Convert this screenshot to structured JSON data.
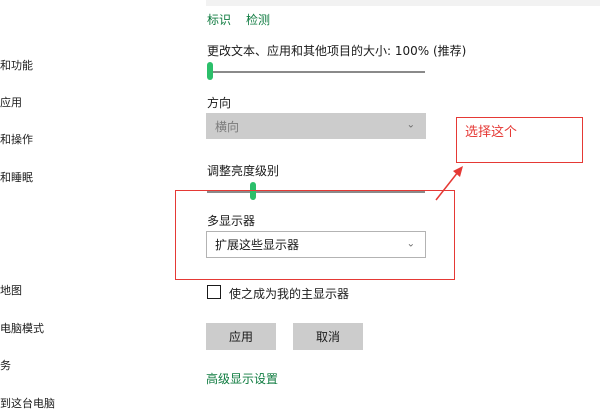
{
  "sidebar": {
    "items": [
      {
        "label": "和功能"
      },
      {
        "label": "应用"
      },
      {
        "label": "和操作"
      },
      {
        "label": "和睡眠"
      },
      {
        "label": "地图"
      },
      {
        "label": "电脑模式"
      },
      {
        "label": "务"
      },
      {
        "label": "到这台电脑"
      }
    ]
  },
  "main": {
    "links": {
      "identify": "标识",
      "detect": "检测"
    },
    "scale": {
      "label": "更改文本、应用和其他项目的大小: 100% (推荐)",
      "value_percent": 0
    },
    "orientation": {
      "label": "方向",
      "value": "横向"
    },
    "brightness": {
      "label": "调整亮度级别",
      "value_percent": 0.2
    },
    "multiple_displays": {
      "label": "多显示器",
      "value": "扩展这些显示器"
    },
    "main_display_checkbox": {
      "label": "使之成为我的主显示器",
      "checked": false
    },
    "apply_button": "应用",
    "cancel_button": "取消",
    "advanced_link": "高级显示设置"
  },
  "annotation": {
    "text": "选择这个",
    "color": "#e53935"
  },
  "colors": {
    "accent": "#107c41",
    "slider": "#2bbf6a"
  }
}
